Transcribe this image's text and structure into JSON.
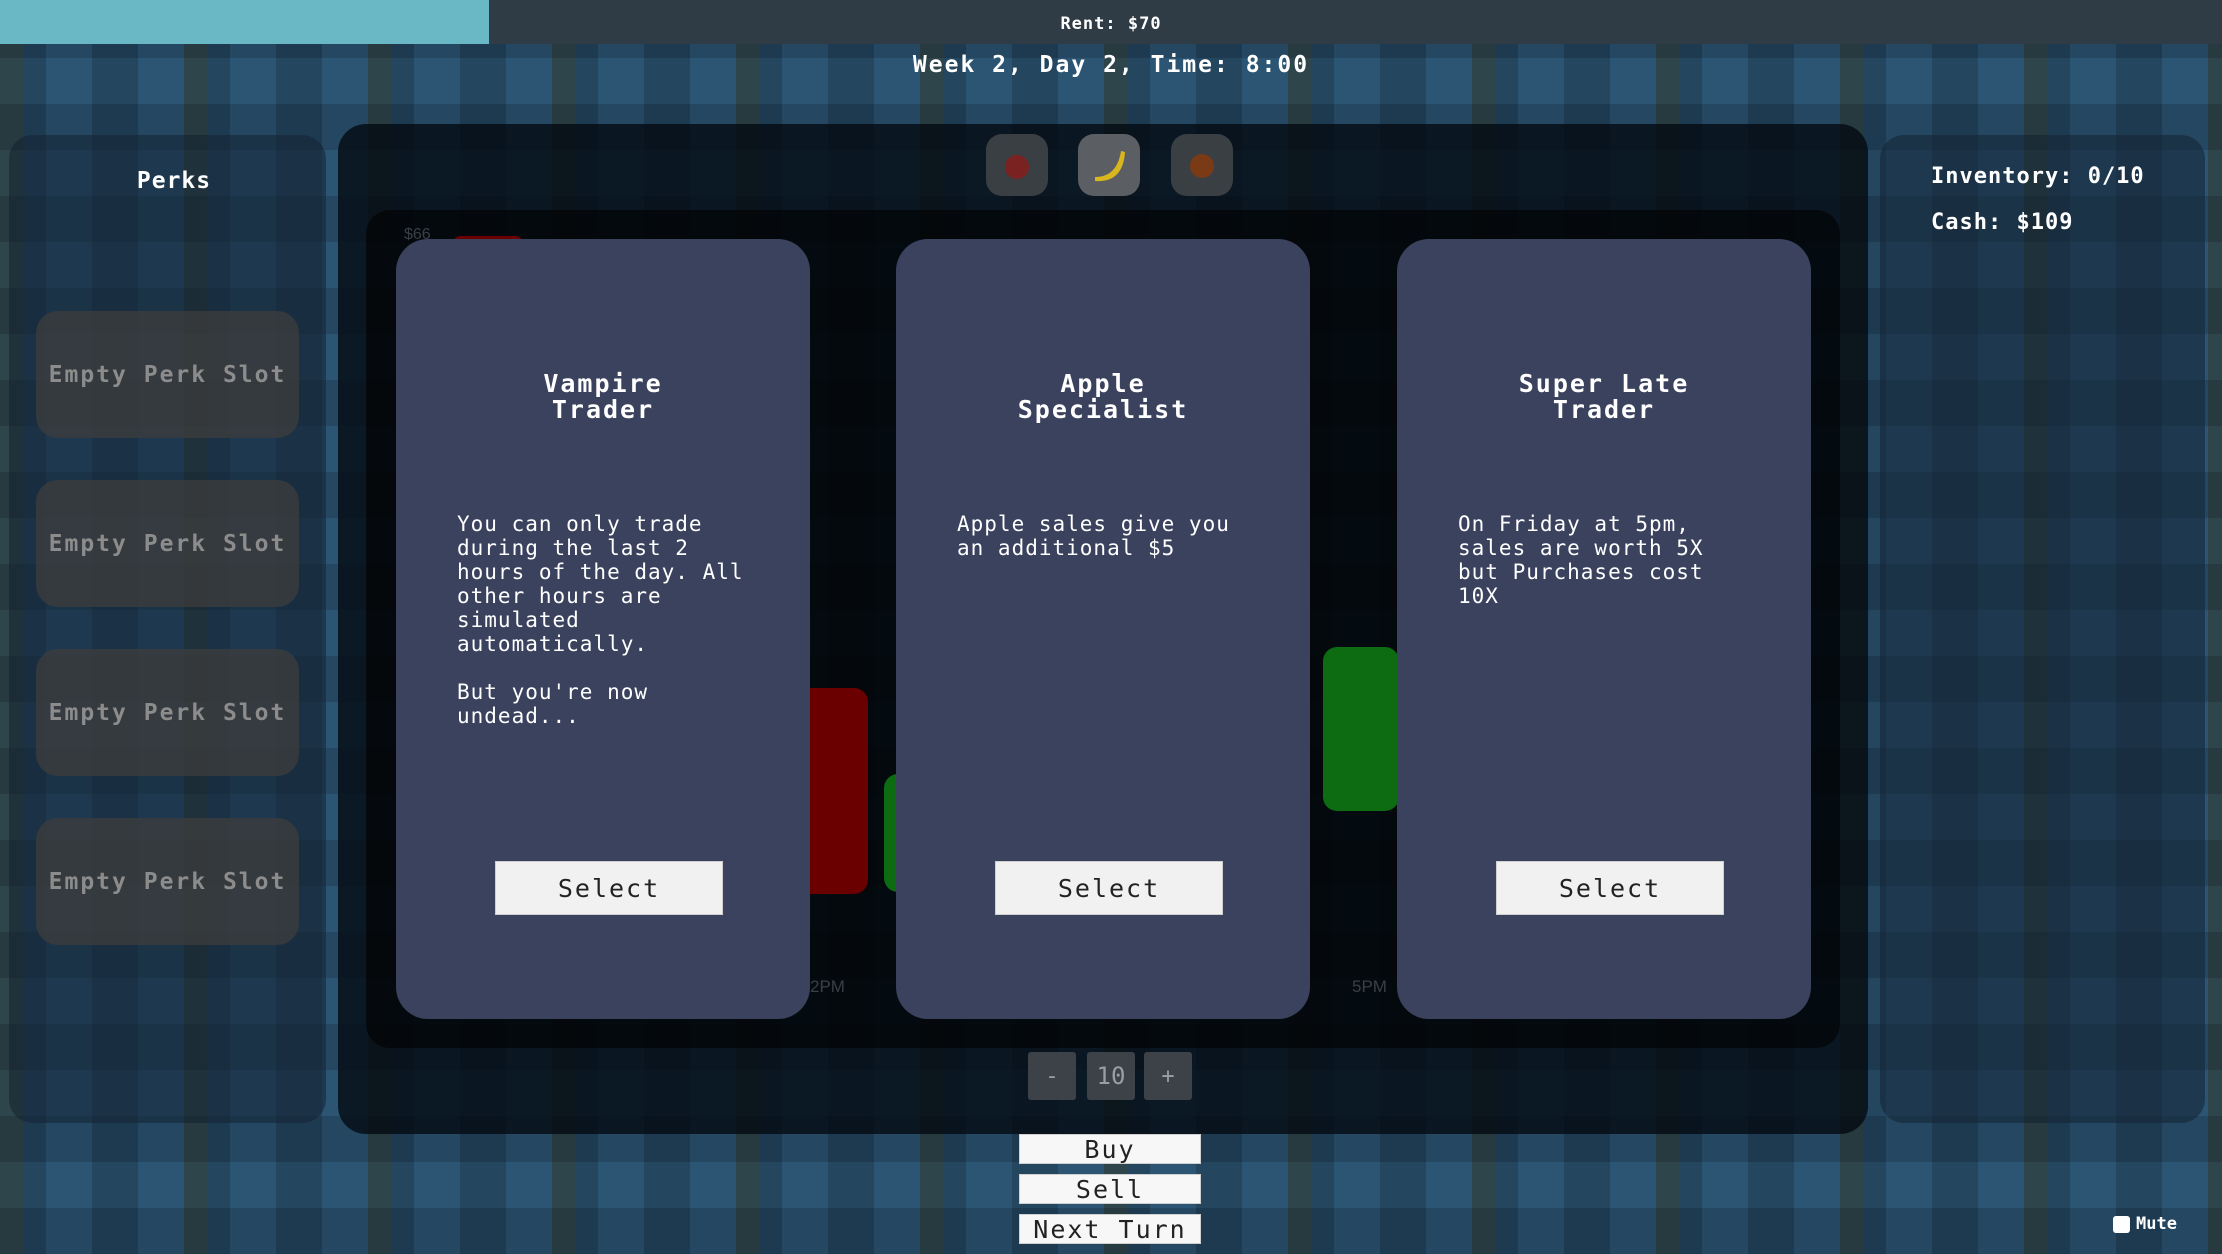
{
  "top": {
    "rent_label": "Rent: $70",
    "rent_progress": 0.22,
    "clock": "Week 2, Day 2, Time: 8:00"
  },
  "perks": {
    "title": "Perks",
    "slots": [
      "Empty Perk Slot",
      "Empty Perk Slot",
      "Empty Perk Slot",
      "Empty Perk Slot"
    ]
  },
  "stats": {
    "inventory": "Inventory: 0/10",
    "cash": "Cash: $109"
  },
  "market": {
    "fruit_tabs": [
      "apple-icon",
      "banana-icon",
      "orange-icon"
    ],
    "price_label": "$66",
    "time_ticks": [
      "2PM",
      "5PM"
    ],
    "colors": {
      "down": "#6b0000",
      "up": "#0d6b12"
    }
  },
  "cards": [
    {
      "title": "Vampire\nTrader",
      "description": "You can only trade\nduring the last 2\nhours of the day. All\nother hours are\nsimulated\nautomatically.\n\nBut you're now\nundead...",
      "button": "Select"
    },
    {
      "title": "Apple\nSpecialist",
      "description": "Apple sales give you\nan additional $5",
      "button": "Select"
    },
    {
      "title": "Super Late\nTrader",
      "description": "On Friday at 5pm,\nsales are worth 5X\nbut Purchases cost\n10X",
      "button": "Select"
    }
  ],
  "quantity": {
    "minus": "-",
    "value": "10",
    "plus": "+"
  },
  "actions": {
    "buy": "Buy",
    "sell": "Sell",
    "next_turn": "Next Turn"
  },
  "mute_label": "Mute"
}
